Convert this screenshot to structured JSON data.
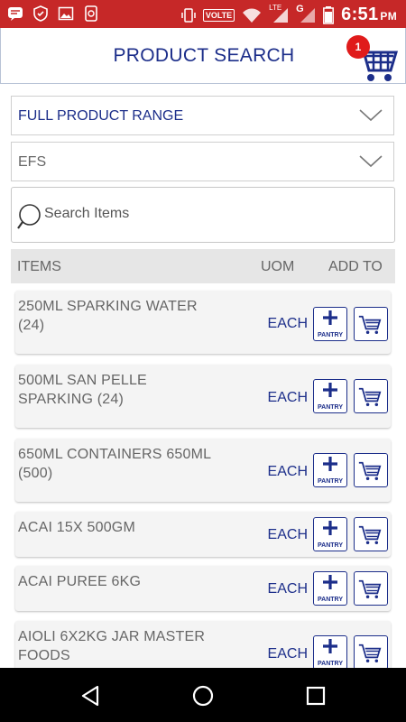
{
  "status_bar": {
    "network_label": "VOLTE",
    "lte_label": "LTE",
    "g_label": "G",
    "time": "6:51",
    "ampm": "PM"
  },
  "header": {
    "title": "PRODUCT SEARCH",
    "cart_count": "1"
  },
  "filters": {
    "range_selected": "FULL PRODUCT RANGE",
    "supplier_selected": "EFS"
  },
  "search": {
    "placeholder": "Search Items"
  },
  "columns": {
    "items": "ITEMS",
    "uom": "UOM",
    "add_to": "ADD TO"
  },
  "pantry_label": "PANTRY",
  "products": [
    {
      "name": "250ML SPARKING WATER (24)",
      "uom": "EACH"
    },
    {
      "name": "500ML SAN PELLE SPARKING (24)",
      "uom": "EACH"
    },
    {
      "name": "650ML CONTAINERS 650ML (500)",
      "uom": "EACH"
    },
    {
      "name": "ACAI 15X 500GM",
      "uom": "EACH"
    },
    {
      "name": "ACAI PUREE 6KG",
      "uom": "EACH"
    },
    {
      "name": "AIOLI  6X2KG JAR MASTER FOODS",
      "uom": "EACH"
    }
  ],
  "colors": {
    "status_bar": "#c62828",
    "brand_blue": "#1c2e8a",
    "badge_red": "#e01b1b"
  }
}
